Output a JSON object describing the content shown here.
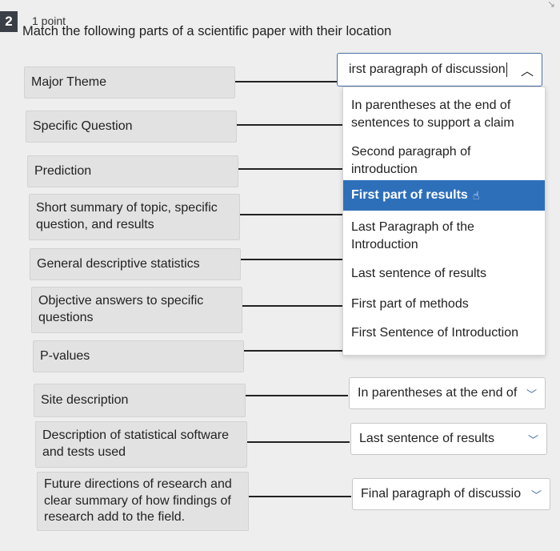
{
  "question": {
    "number": "2",
    "points": "1 point",
    "prompt": "Match the following parts of a scientific paper with their location"
  },
  "left_items": [
    "Major Theme",
    "Specific Question",
    "Prediction",
    "Short summary of topic, specific question, and results",
    "General descriptive statistics",
    "Objective answers to specific questions",
    "P-values",
    "Site description",
    "Description of statistical software and tests used",
    "Future directions of research and clear summary of how findings of research add to the field."
  ],
  "open_dropdown": {
    "value": "irst paragraph of discussion",
    "icon": "chevron-up-icon"
  },
  "menu_options": [
    "In parentheses at the end of sentences to support a claim",
    "Second paragraph of introduction",
    "First part of results",
    "Last Paragraph of the Introduction",
    "Last sentence of results",
    "First part of methods",
    "First Sentence of Introduction"
  ],
  "highlighted_option_index": 2,
  "closed_dropdowns": [
    {
      "value": "In parentheses at the end of",
      "icon": "chevron-down-icon"
    },
    {
      "value": "Last sentence of results",
      "icon": "chevron-down-icon"
    },
    {
      "value": "Final paragraph of discussio",
      "icon": "chevron-down-icon"
    }
  ],
  "colors": {
    "highlight": "#2e6fba",
    "question_badge": "#3a3f47",
    "left_box": "#e2e2e2"
  }
}
